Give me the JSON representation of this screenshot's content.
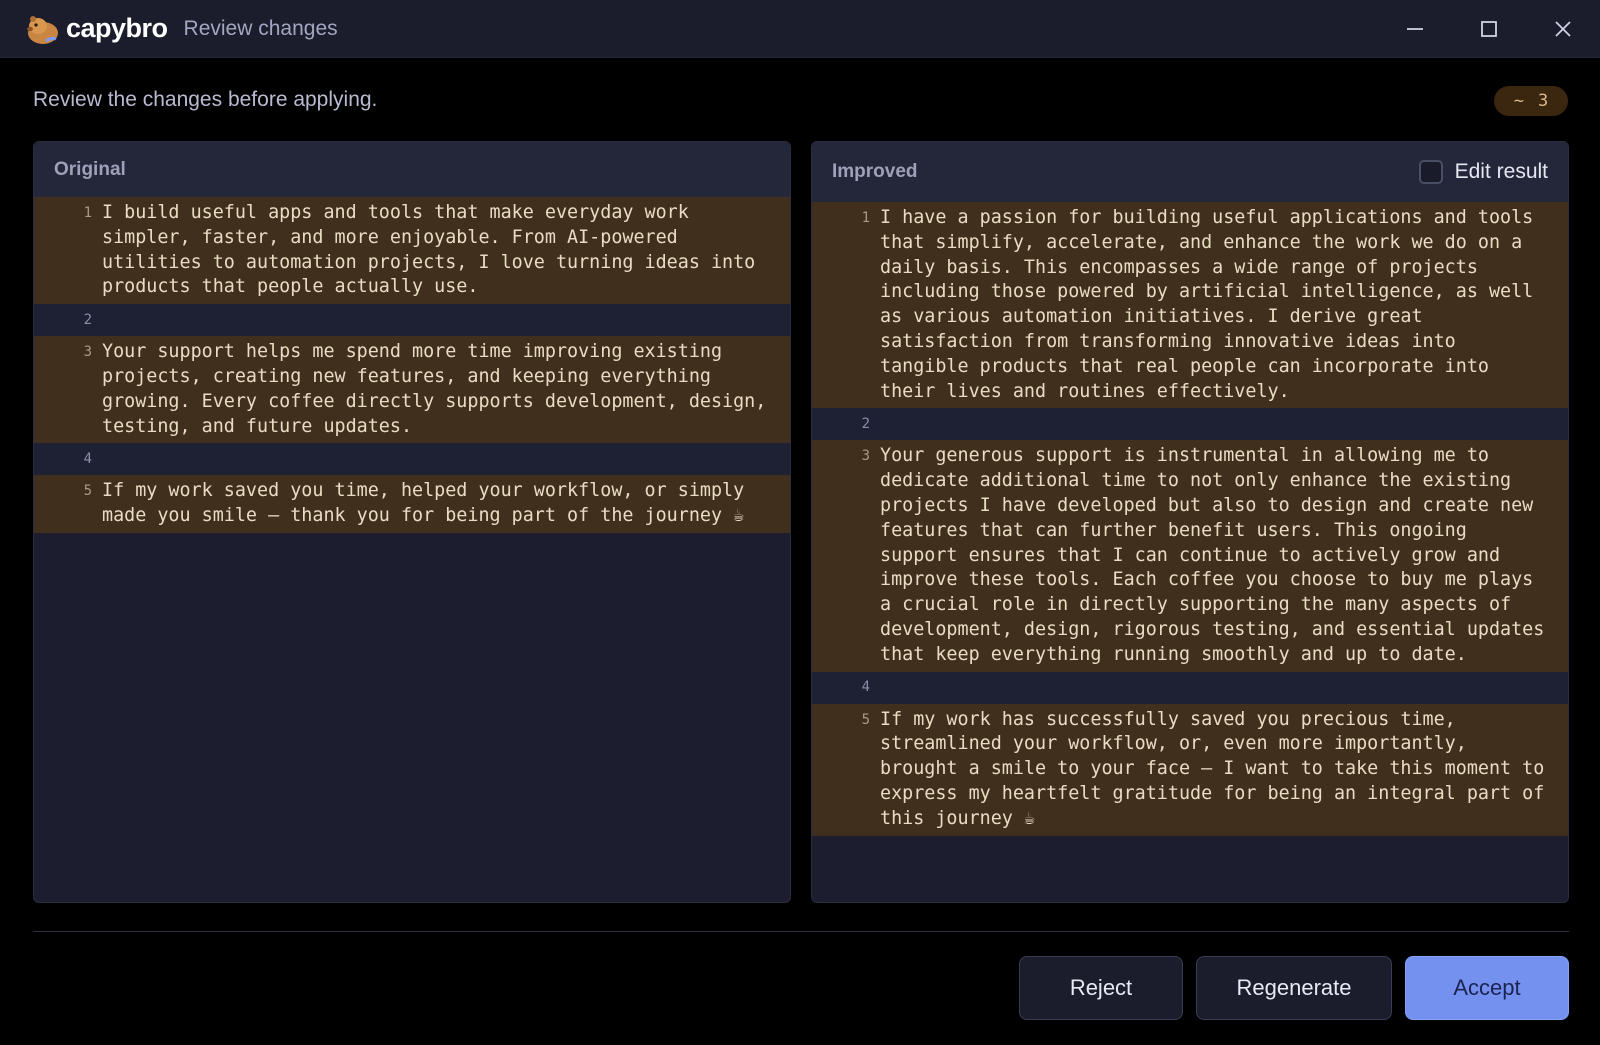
{
  "titlebar": {
    "brand": "capybro",
    "window_title": "Review changes"
  },
  "subheader": {
    "text": "Review the changes before applying.",
    "counter_symbol": "~",
    "counter_value": "3"
  },
  "original": {
    "title": "Original",
    "lines": [
      {
        "num": "1",
        "text": "I build useful apps and tools that make everyday work simpler, faster, and more enjoyable. From AI-powered utilities to automation projects, I love turning ideas into products that people actually use."
      },
      {
        "num": "2",
        "text": ""
      },
      {
        "num": "3",
        "text": "Your support helps me spend more time improving existing projects, creating new features, and keeping everything growing. Every coffee directly supports development, design, testing, and future updates."
      },
      {
        "num": "4",
        "text": ""
      },
      {
        "num": "5",
        "text": "If my work saved you time, helped your workflow, or simply made you smile — thank you for being part of the journey ☕"
      }
    ]
  },
  "improved": {
    "title": "Improved",
    "edit_label": "Edit result",
    "lines": [
      {
        "num": "1",
        "text": "I have a passion for building useful applications and tools that simplify, accelerate, and enhance the work we do on a daily basis. This encompasses a wide range of projects including those powered by artificial intelligence, as well as various automation initiatives. I derive great satisfaction from transforming innovative ideas into tangible products that real people can incorporate into their lives and routines effectively."
      },
      {
        "num": "2",
        "text": ""
      },
      {
        "num": "3",
        "text": "Your generous support is instrumental in allowing me to dedicate additional time to not only enhance the existing projects I have developed but also to design and create new features that can further benefit users. This ongoing support ensures that I can continue to actively grow and improve these tools. Each coffee you choose to buy me plays a crucial role in directly supporting the many aspects of development, design, rigorous testing, and essential updates that keep everything running smoothly and up to date."
      },
      {
        "num": "4",
        "text": ""
      },
      {
        "num": "5",
        "text": "If my work has successfully saved you precious time, streamlined your workflow, or, even more importantly, brought a smile to your face — I want to take this moment to express my heartfelt gratitude for being an integral part of this journey ☕"
      }
    ]
  },
  "actions": {
    "reject": "Reject",
    "regenerate": "Regenerate",
    "accept": "Accept"
  },
  "colors": {
    "background": "#000000",
    "panel": "#1c1d2e",
    "changed_line": "#3f2f1c",
    "accent": "#7591f0"
  }
}
